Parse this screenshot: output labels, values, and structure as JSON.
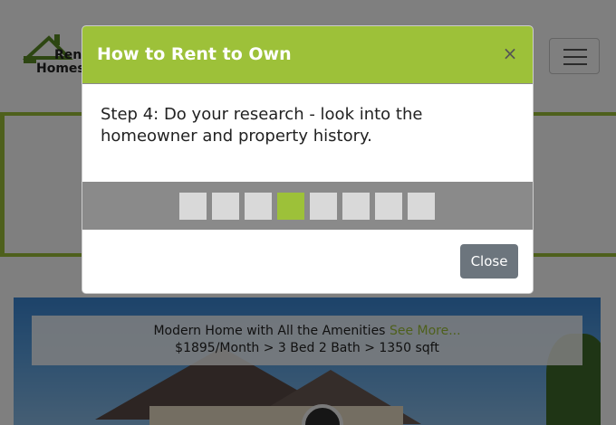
{
  "site": {
    "logo_line1": "Rent",
    "logo_line2": "Homes",
    "listing": {
      "title": "Modern Home with All the Amenities",
      "see_more": "See More...",
      "details": "$1895/Month > 3 Bed 2 Bath > 1350 sqft"
    }
  },
  "modal": {
    "title": "How to Rent to Own",
    "close_symbol": "×",
    "step_text": "Step 4: Do your research - look into the homeowner and property history.",
    "steps_total": 8,
    "current_step": 4,
    "close_label": "Close"
  },
  "colors": {
    "accent": "#9dc139",
    "close_button": "#6c757d",
    "step_strip": "#8a8a8a"
  }
}
